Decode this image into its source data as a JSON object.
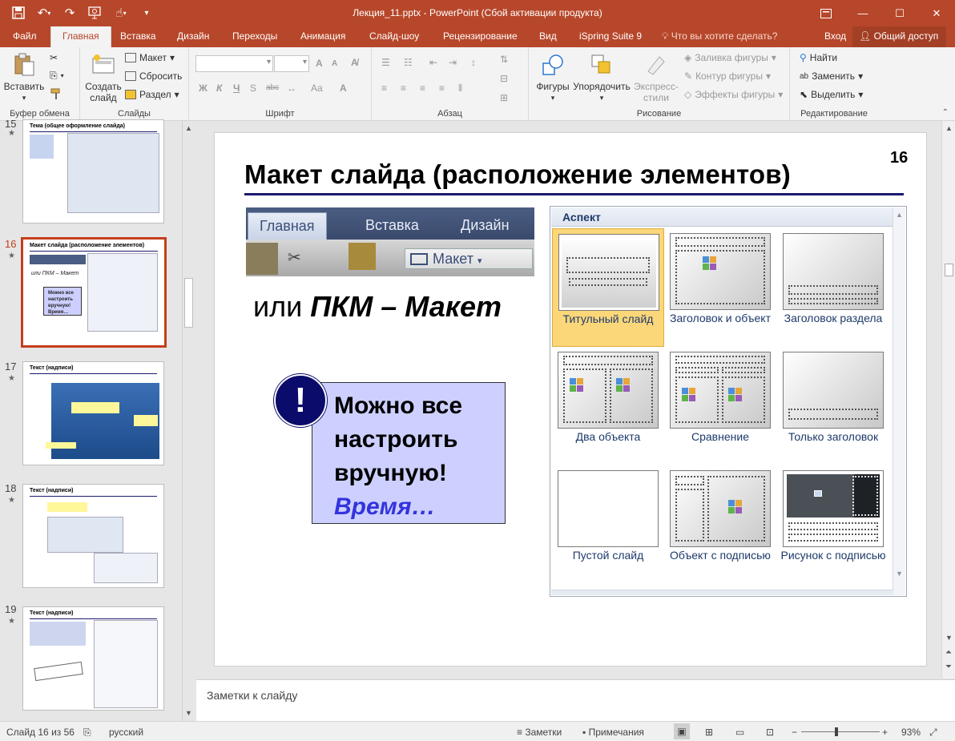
{
  "window": {
    "title": "Лекция_11.pptx - PowerPoint (Сбой активации продукта)",
    "accent_color": "#b7472a"
  },
  "qat": {
    "icons": [
      "save-icon",
      "undo-icon",
      "redo-icon",
      "present-from-start-icon",
      "touch-mode-icon",
      "customize-qat-icon"
    ]
  },
  "tabs": {
    "file": "Файл",
    "home": "Главная",
    "insert": "Вставка",
    "design": "Дизайн",
    "transitions": "Переходы",
    "animation": "Анимация",
    "slideshow": "Слайд-шоу",
    "review": "Рецензирование",
    "view": "Вид",
    "ispring": "iSpring Suite 9",
    "tellme": "Что вы хотите сделать?",
    "signin": "Вход",
    "share": "Общий доступ"
  },
  "ribbon": {
    "clipboard": {
      "label": "Буфер обмена",
      "paste": "Вставить"
    },
    "slides": {
      "label": "Слайды",
      "new_slide": "Создать слайд",
      "layout": "Макет",
      "reset": "Сбросить",
      "section": "Раздел"
    },
    "font": {
      "label": "Шрифт",
      "bold": "Ж",
      "italic": "К",
      "underline": "Ч",
      "strike": "abc",
      "grow": "A",
      "shrink": "A",
      "case": "Aa"
    },
    "paragraph": {
      "label": "Абзац"
    },
    "drawing": {
      "label": "Рисование",
      "shapes": "Фигуры",
      "arrange": "Упорядочить",
      "quick_styles": "Экспресс-стили",
      "fill": "Заливка фигуры",
      "outline": "Контур фигуры",
      "effects": "Эффекты фигуры"
    },
    "editing": {
      "label": "Редактирование",
      "find": "Найти",
      "replace": "Заменить",
      "select": "Выделить"
    }
  },
  "thumbnails": [
    {
      "num": "15",
      "title": "Тема (общее оформление слайда)",
      "selected": false
    },
    {
      "num": "16",
      "title": "Макет слайда (расположение элементов)",
      "subtitle": "или ПКМ – Макет",
      "note": "Можно все настроить вручную! Время…",
      "selected": true
    },
    {
      "num": "17",
      "title": "Текст (надписи)",
      "selected": false
    },
    {
      "num": "18",
      "title": "Текст (надписи)",
      "selected": false
    },
    {
      "num": "19",
      "title": "Текст (надписи)",
      "selected": false
    }
  ],
  "slide": {
    "number": "16",
    "title": "Макет слайда (расположение элементов)",
    "ribbon_tabs": [
      "Главная",
      "Вставка",
      "Дизайн"
    ],
    "maket_button": "Макет",
    "or_prefix": "или ",
    "or_emph": "ПКМ – Макет",
    "callout_mark": "!",
    "callout_lines": [
      "Можно все",
      "настроить",
      "вручную!"
    ],
    "callout_emph": "Время…",
    "gallery_header": "Аспект",
    "layouts": [
      {
        "label": "Титульный слайд",
        "selected": true
      },
      {
        "label": "Заголовок и объект",
        "selected": false
      },
      {
        "label": "Заголовок раздела",
        "selected": false
      },
      {
        "label": "Два объекта",
        "selected": false
      },
      {
        "label": "Сравнение",
        "selected": false
      },
      {
        "label": "Только заголовок",
        "selected": false
      },
      {
        "label": "Пустой слайд",
        "selected": false
      },
      {
        "label": "Объект с подписью",
        "selected": false
      },
      {
        "label": "Рисунок с подписью",
        "selected": false
      }
    ]
  },
  "notes": {
    "placeholder": "Заметки к слайду"
  },
  "status": {
    "slide_of": "Слайд 16 из 56",
    "language": "русский",
    "notes": "Заметки",
    "comments": "Примечания",
    "zoom": "93%"
  }
}
